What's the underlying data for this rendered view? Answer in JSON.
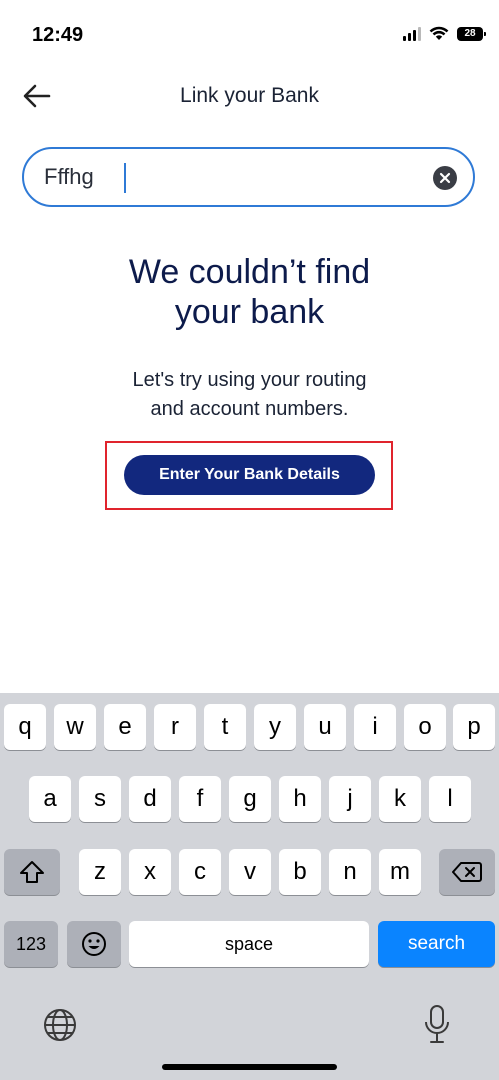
{
  "status_bar": {
    "time": "12:49",
    "battery": "28"
  },
  "header": {
    "title": "Link your Bank"
  },
  "search": {
    "value": "Fffhg"
  },
  "main": {
    "headline_line1": "We couldn’t find",
    "headline_line2": "your bank",
    "sub_line1": "Let's try using your routing",
    "sub_line2": "and account numbers.",
    "cta_label": "Enter Your Bank Details"
  },
  "keyboard": {
    "row1": [
      "q",
      "w",
      "e",
      "r",
      "t",
      "y",
      "u",
      "i",
      "o",
      "p"
    ],
    "row2": [
      "a",
      "s",
      "d",
      "f",
      "g",
      "h",
      "j",
      "k",
      "l"
    ],
    "row3": [
      "z",
      "x",
      "c",
      "v",
      "b",
      "n",
      "m"
    ],
    "numbers_label": "123",
    "space_label": "space",
    "search_label": "search"
  },
  "colors": {
    "accent": "#12287e",
    "focus": "#2f7ad6",
    "highlight": "#e0242d",
    "keyboard_action": "#0a84ff"
  }
}
